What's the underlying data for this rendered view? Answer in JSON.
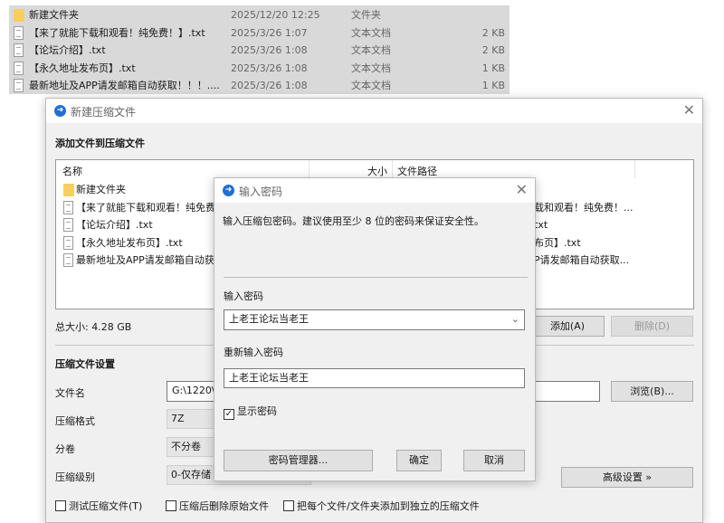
{
  "explorer": {
    "rows": [
      {
        "icon": "folder",
        "name": "新建文件夹",
        "date": "2025/12/20 12:25",
        "type": "文件夹",
        "size": ""
      },
      {
        "icon": "doc",
        "name": "【来了就能下载和观看！纯免费！】.txt",
        "date": "2025/3/26 1:07",
        "type": "文本文档",
        "size": "2 KB"
      },
      {
        "icon": "doc",
        "name": "【论坛介绍】.txt",
        "date": "2025/3/26 1:08",
        "type": "文本文档",
        "size": "2 KB"
      },
      {
        "icon": "doc",
        "name": "【永久地址发布页】.txt",
        "date": "2025/3/26 1:08",
        "type": "文本文档",
        "size": "1 KB"
      },
      {
        "icon": "doc",
        "name": "最新地址及APP请发邮箱自动获取！！！....",
        "date": "2025/3/26 1:08",
        "type": "文本文档",
        "size": "1 KB"
      }
    ]
  },
  "main": {
    "title": "新建压缩文件",
    "section_add": "添加文件到压缩文件",
    "columns": {
      "name": "名称",
      "size": "大小",
      "path": "文件路径"
    },
    "files": [
      {
        "icon": "folder",
        "name": "新建文件夹",
        "path": ""
      },
      {
        "icon": "doc",
        "name": "【来了就能下载和观看！纯免费！】.txt",
        "path": "载和观看！纯免费！..."
      },
      {
        "icon": "doc",
        "name": "【论坛介绍】.txt",
        "path": "txt"
      },
      {
        "icon": "doc",
        "name": "【永久地址发布页】.txt",
        "path": "布页】.txt"
      },
      {
        "icon": "doc",
        "name": "最新地址及APP请发邮箱自动获取",
        "path": "P请发邮箱自动获取..."
      }
    ],
    "total_size": "总大小: 4.28 GB",
    "add_button": "添加(A)",
    "delete_button": "删除(D)",
    "section_settings": "压缩文件设置",
    "filename_label": "文件名",
    "filename_value": "G:\\1220\\",
    "browse_button": "浏览(B)...",
    "format_label": "压缩格式",
    "format_value": "7Z",
    "split_label": "分卷",
    "split_value": "不分卷",
    "level_label": "压缩级别",
    "level_value": "0-仅存储",
    "advanced_button": "高级设置 »",
    "checkboxes": [
      "测试压缩文件(T)",
      "压缩后删除原始文件",
      "把每个文件/文件夹添加到独立的压缩文件"
    ]
  },
  "password": {
    "title": "输入密码",
    "hint": "输入压缩包密码。建议使用至少 8 位的密码来保证安全性。",
    "enter_label": "输入密码",
    "enter_value": "上老王论坛当老王",
    "reenter_label": "重新输入密码",
    "reenter_value": "上老王论坛当老王",
    "show_password": "显示密码",
    "show_checked": true,
    "manager_button": "密码管理器...",
    "ok_button": "确定",
    "cancel_button": "取消"
  }
}
